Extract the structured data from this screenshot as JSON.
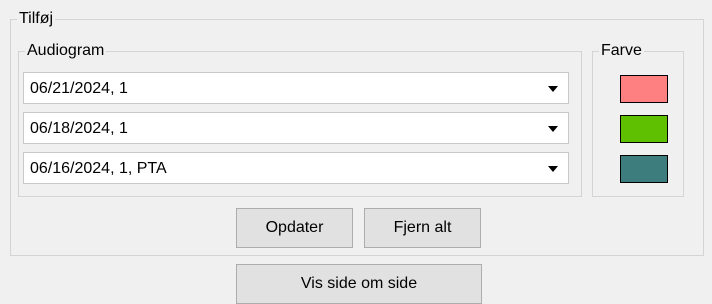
{
  "add_group": {
    "title": "Tilføj"
  },
  "audiogram_group": {
    "title": "Audiogram",
    "selects": [
      {
        "value": "06/21/2024, 1"
      },
      {
        "value": "06/18/2024, 1"
      },
      {
        "value": "06/16/2024, 1, PTA"
      }
    ]
  },
  "color_group": {
    "title": "Farve",
    "swatches": [
      "#ff8080",
      "#5ec000",
      "#3d7d7d"
    ]
  },
  "buttons": {
    "update": "Opdater",
    "remove_all": "Fjern alt",
    "side_by_side": "Vis side om side"
  }
}
